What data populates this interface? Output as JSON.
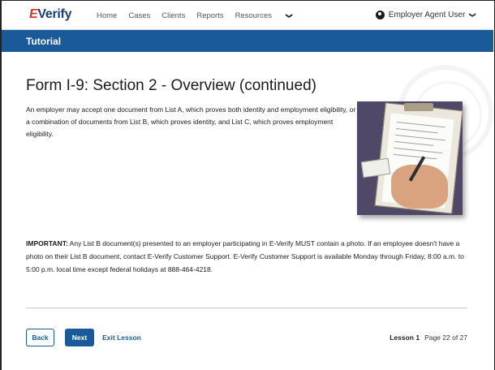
{
  "nav": {
    "logo_prefix": "E",
    "logo_text": "Verify",
    "links": [
      "Home",
      "Cases",
      "Clients",
      "Reports",
      "Resources"
    ],
    "resources_caret": "❯",
    "user_label": "Employer Agent User",
    "user_caret": "❯"
  },
  "banner": {
    "title": "Tutorial"
  },
  "content": {
    "title": "Form I-9: Section 2 - Overview (continued)",
    "intro": "An employer may accept one document from List A, which proves both identity and employment eligibility, or a combination of documents from List B, which proves identity, and List C, which proves employment eligibility.",
    "important_label": "IMPORTANT:",
    "important_text": " Any List B document(s) presented to an employer participating in E-Verify MUST contain a photo. If an employee doesn't have a photo on their List B document, contact E-Verify Customer Support. E-Verify Customer Support is available Monday through Friday, 8:00 a.m. to 5:00 p.m. local time except federal holidays at 888-464-4218."
  },
  "footer": {
    "back_label": "Back",
    "next_label": "Next",
    "exit_label": "Exit Lesson",
    "lesson_label": "Lesson 1",
    "page_label": "Page 22 of 27"
  },
  "colors": {
    "brand_blue": "#1b5a98",
    "logo_red": "#d83933",
    "navy": "#1b3f75"
  },
  "icons": {
    "user": "user-circle-icon",
    "caret": "chevron-down-icon"
  }
}
